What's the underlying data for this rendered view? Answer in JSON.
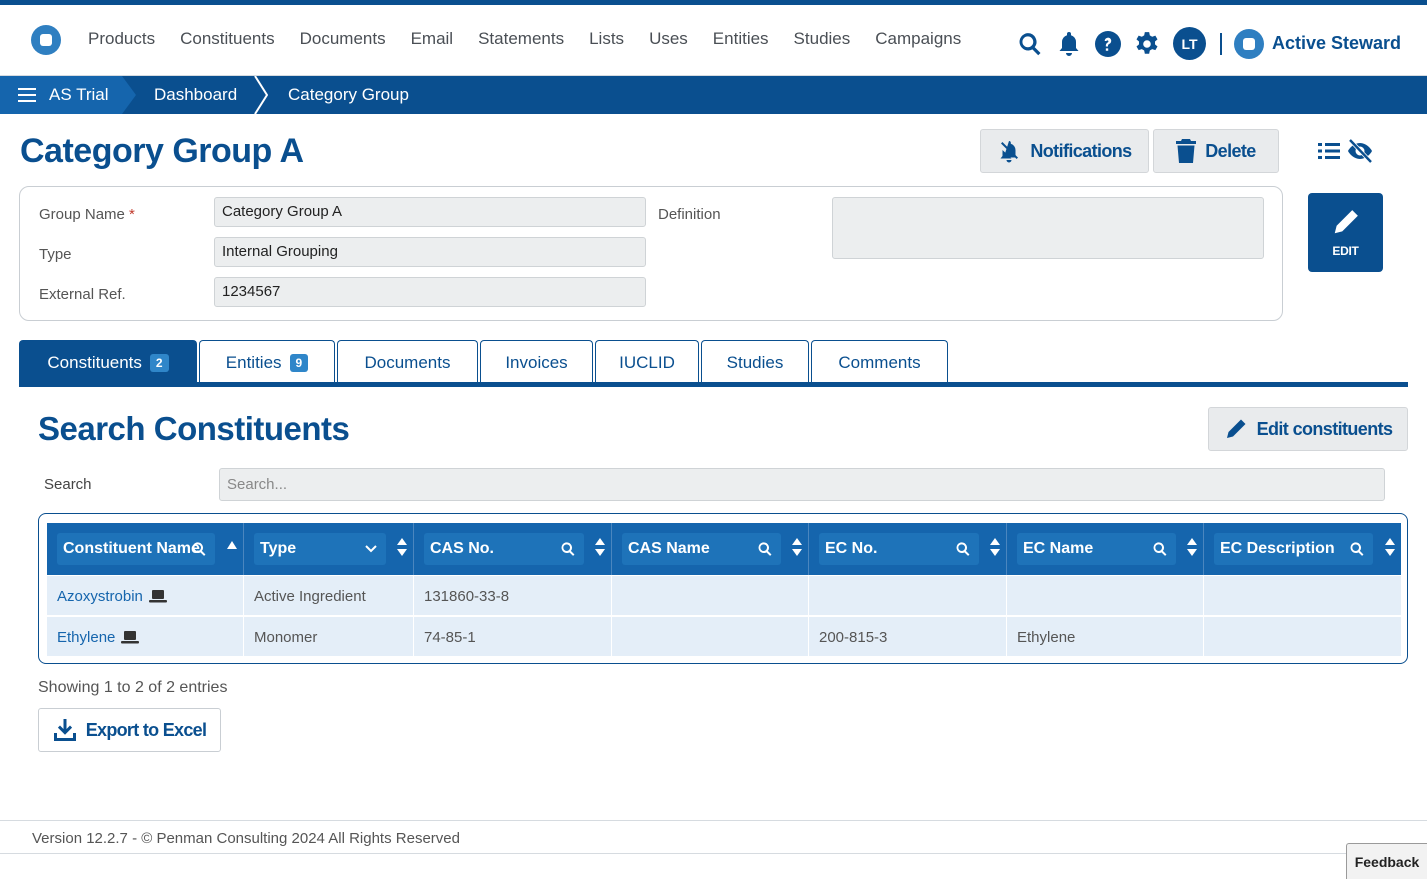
{
  "nav": {
    "items": [
      "Products",
      "Constituents",
      "Documents",
      "Email",
      "Statements",
      "Lists",
      "Uses",
      "Entities",
      "Studies",
      "Campaigns"
    ],
    "user_initials": "LT",
    "brand": "Active Steward"
  },
  "breadcrumb": {
    "items": [
      "AS Trial",
      "Dashboard",
      "Category Group"
    ]
  },
  "page": {
    "title": "Category Group A",
    "notifications_label": "Notifications",
    "delete_label": "Delete",
    "edit_label": "EDIT"
  },
  "form": {
    "group_name_label": "Group Name",
    "required_mark": "*",
    "group_name_value": "Category Group A",
    "type_label": "Type",
    "type_value": "Internal Grouping",
    "external_ref_label": "External Ref.",
    "external_ref_value": "1234567",
    "definition_label": "Definition",
    "definition_value": ""
  },
  "tabs": [
    {
      "label": "Constituents",
      "badge": "2",
      "active": true
    },
    {
      "label": "Entities",
      "badge": "9",
      "active": false
    },
    {
      "label": "Documents",
      "badge": "",
      "active": false
    },
    {
      "label": "Invoices",
      "badge": "",
      "active": false
    },
    {
      "label": "IUCLID",
      "badge": "",
      "active": false
    },
    {
      "label": "Studies",
      "badge": "",
      "active": false
    },
    {
      "label": "Comments",
      "badge": "",
      "active": false
    }
  ],
  "section": {
    "title": "Search Constituents",
    "edit_constituents_label": "Edit constituents",
    "search_label": "Search",
    "search_placeholder": "Search..."
  },
  "table": {
    "columns": [
      "Constituent Name",
      "Type",
      "CAS No.",
      "CAS Name",
      "EC No.",
      "EC Name",
      "EC Description"
    ],
    "rows": [
      [
        "Azoxystrobin",
        "Active Ingredient",
        "131860-33-8",
        "",
        "",
        "",
        ""
      ],
      [
        "Ethylene",
        "Monomer",
        "74-85-1",
        "",
        "200-815-3",
        "Ethylene",
        ""
      ]
    ],
    "showing": "Showing 1 to 2 of 2 entries",
    "export_label": "Export to Excel"
  },
  "footer": {
    "text": "Version 12.2.7 - © Penman Consulting 2024 All Rights Reserved",
    "feedback": "Feedback"
  },
  "colors": {
    "primary": "#0a4f8f",
    "accent": "#1565ad",
    "row_bg": "#e4eef8"
  },
  "icons": [
    "search-icon",
    "bell-icon",
    "help-icon",
    "gear-icon",
    "bell-slash-icon",
    "trash-icon",
    "list-icon",
    "eye-slash-icon",
    "pencil-icon",
    "laptop-icon",
    "download-icon"
  ]
}
